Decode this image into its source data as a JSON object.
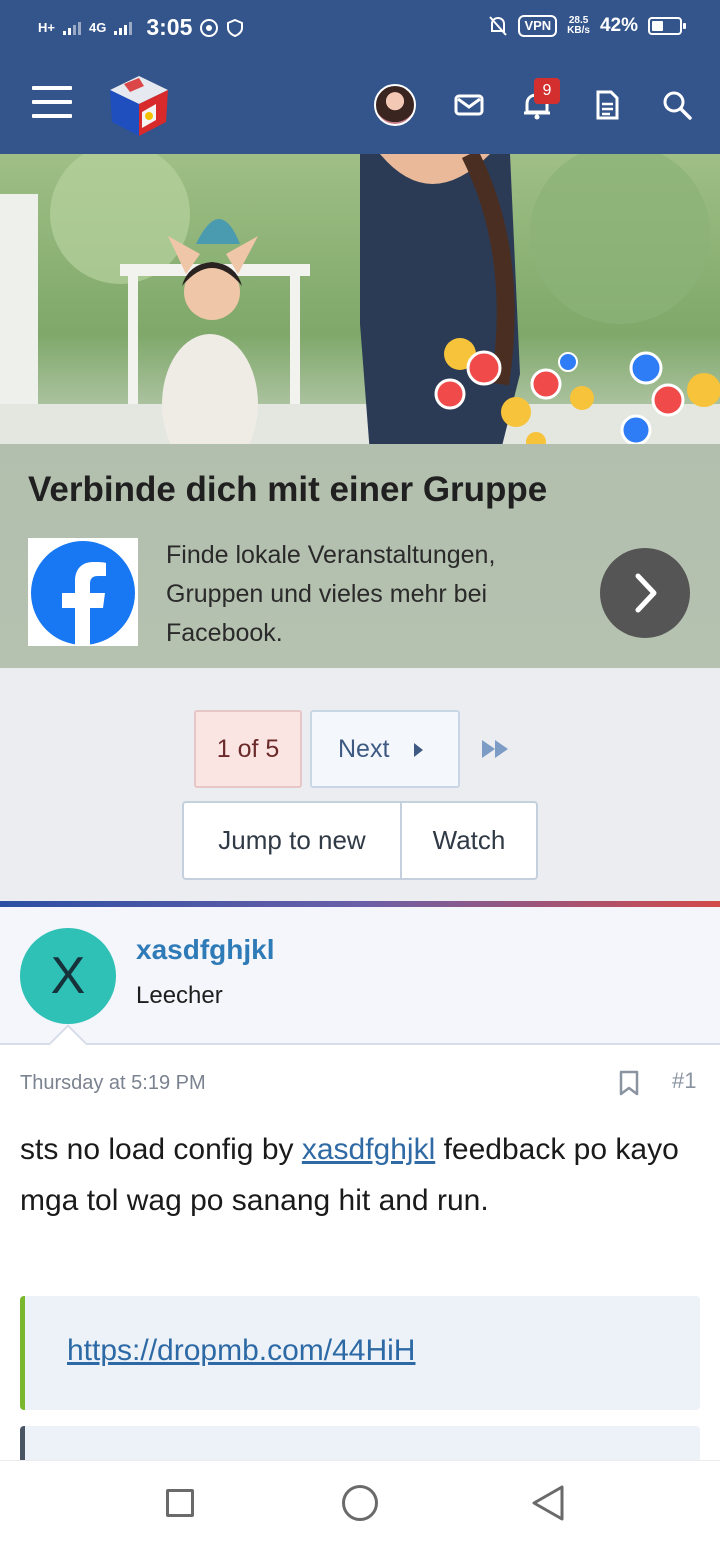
{
  "status_bar": {
    "network_1": "H+",
    "network_2": "4G",
    "time": "3:05",
    "vpn": "VPN",
    "speed_value": "28.5",
    "speed_unit": "KB/s",
    "battery_percent": "42%",
    "battery_level": 0.42
  },
  "navbar": {
    "notification_count": "9",
    "icons": [
      "menu-icon",
      "site-logo",
      "user-avatar",
      "inbox-icon",
      "bell-icon",
      "document-icon",
      "search-icon"
    ]
  },
  "ad": {
    "title": "Verbinde dich mit einer Gruppe",
    "text": "Finde lokale Veranstaltungen, Gruppen und vieles mehr bei Facebook.",
    "brand_color": "#1877f2"
  },
  "pagination": {
    "current": "1 of 5",
    "next": "Next"
  },
  "actions": {
    "jump": "Jump to new",
    "watch": "Watch"
  },
  "post": {
    "avatar_letter": "X",
    "username": "xasdfghjkl",
    "role": "Leecher",
    "date": "Thursday at 5:19 PM",
    "number": "#1",
    "body_before": "sts no load config by ",
    "body_mention": "xasdfghjkl",
    "body_after": " feedback po kayo mga tol wag po sanang hit and run.",
    "link": "https://dropmb.com/44HiH"
  },
  "colors": {
    "header_bg": "#34558b",
    "accent_link": "#2f7bb7",
    "quote_bar": "#79b82c",
    "badge": "#d32f2f"
  }
}
